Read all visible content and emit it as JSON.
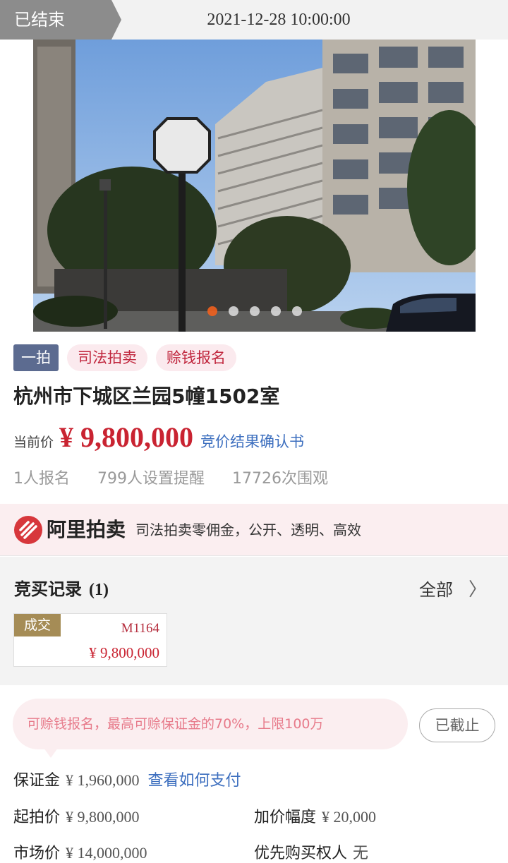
{
  "topbar": {
    "status": "已结束",
    "end_time": "2021-12-28 10:00:00"
  },
  "gallery": {
    "slides": 5,
    "active_index": 0
  },
  "tags": [
    "一拍",
    "司法拍卖",
    "赊钱报名"
  ],
  "title": "杭州市下城区兰园5幢1502室",
  "price": {
    "label": "当前价",
    "value": "¥ 9,800,000",
    "link": "竞价结果确认书"
  },
  "stats": [
    "1人报名",
    "799人设置提醒",
    "17726次围观"
  ],
  "banner": {
    "logo": "阿里拍卖",
    "slogan": "司法拍卖零佣金，公开、透明、高效"
  },
  "records": {
    "title": "竞买记录",
    "count": "(1)",
    "all_label": "全部",
    "items": [
      {
        "badge": "成交",
        "user": "M1164",
        "price": "¥ 9,800,000"
      }
    ]
  },
  "notice": {
    "text": "可赊钱报名，最高可赊保证金的70%，上限100万",
    "button": "已截止"
  },
  "deposit": {
    "label": "保证金",
    "value": "¥ 1,960,000",
    "link": "查看如何支付"
  },
  "info": {
    "start_price": {
      "label": "起拍价",
      "value": "¥ 9,800,000"
    },
    "increment": {
      "label": "加价幅度",
      "value": "¥ 20,000"
    },
    "market_price": {
      "label": "市场价",
      "value": "¥ 14,000,000"
    },
    "priority_buyer": {
      "label": "优先购买权人",
      "value": "无"
    }
  },
  "colors": {
    "accent_red": "#c92331",
    "link_blue": "#3d6fbf",
    "badge_gold": "#a58c56",
    "dot_active": "#f1601e"
  }
}
